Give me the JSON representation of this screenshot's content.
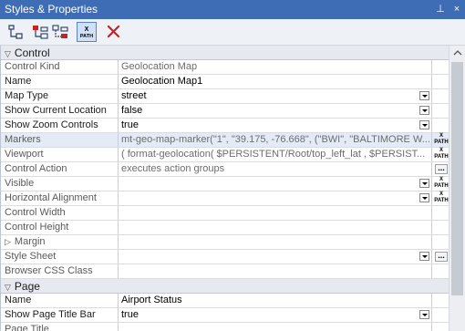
{
  "window": {
    "title": "Styles & Properties",
    "pin_glyph": "⊥",
    "close_glyph": "×"
  },
  "toolbar": {
    "tools": [
      {
        "name": "tree-icon"
      },
      {
        "name": "add-style-icon"
      },
      {
        "name": "remove-style-icon"
      },
      {
        "name": "xpath-icon",
        "label": "XPATH"
      },
      {
        "name": "delete-icon"
      }
    ]
  },
  "sections": {
    "control": {
      "title": "Control",
      "rows": [
        {
          "name": "Control Kind",
          "value": "Geolocation Map"
        },
        {
          "name": "Name",
          "value": "Geolocation Map1"
        },
        {
          "name": "Map Type",
          "value": "street"
        },
        {
          "name": "Show Current Location",
          "value": "false"
        },
        {
          "name": "Show Zoom Controls",
          "value": "true"
        },
        {
          "name": "Markers",
          "value": "mt-geo-map-marker(\"1\", \"39.175, -76.668\", (\"BWI\", \"BALTIMORE W..."
        },
        {
          "name": "Viewport",
          "value": "( format-geolocation( $PERSISTENT/Root/top_left_lat , $PERSIST..."
        },
        {
          "name": "Control Action",
          "value": "executes action groups"
        },
        {
          "name": "Visible",
          "value": ""
        },
        {
          "name": "Horizontal Alignment",
          "value": ""
        },
        {
          "name": "Control Width",
          "value": ""
        },
        {
          "name": "Control Height",
          "value": ""
        },
        {
          "name": "Margin",
          "value": ""
        },
        {
          "name": "Style Sheet",
          "value": ""
        },
        {
          "name": "Browser CSS Class",
          "value": ""
        }
      ]
    },
    "page": {
      "title": "Page",
      "rows": [
        {
          "name": "Name",
          "value": "Airport Status"
        },
        {
          "name": "Show Page Title Bar",
          "value": "true"
        },
        {
          "name": "Page Title",
          "value": ""
        }
      ]
    }
  },
  "xpath_label_top": "X",
  "xpath_label_bottom": "PATH",
  "ellipsis_label": "...",
  "colors": {
    "titlebar": "#3e6db5",
    "section_bg": "#e6e9ef",
    "selected_row": "#e4ebf7",
    "delete_red": "#cc1f1f"
  }
}
